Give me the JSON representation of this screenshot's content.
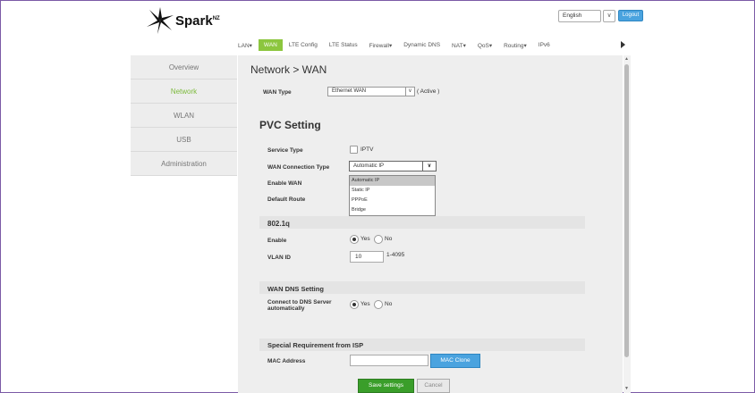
{
  "brand": {
    "name": "Spark",
    "suffix": "NZ"
  },
  "header": {
    "language": "English",
    "language_arrow": "∨",
    "logout": "Logout"
  },
  "topnav": [
    "LAN▾",
    "WAN",
    "LTE Config",
    "LTE Status",
    "Firewall▾",
    "Dynamic DNS",
    "NAT▾",
    "QoS▾",
    "Routing▾",
    "IPv6"
  ],
  "topnav_active": "WAN",
  "sidebar": [
    "Overview",
    "Network",
    "WLAN",
    "USB",
    "Administration"
  ],
  "sidebar_active": "Network",
  "breadcrumb": "Network > WAN",
  "wan_type": {
    "label": "WAN Type",
    "value": "Ethernet WAN",
    "status": "( Active )"
  },
  "pvc": {
    "title": "PVC Setting",
    "service_type_label": "Service Type",
    "iptv_label": "IPTV",
    "conn_type_label": "WAN Connection Type",
    "conn_type_value": "Automatic IP",
    "enable_wan_label": "Enable WAN",
    "default_route_label": "Default Route",
    "options": [
      "Automatic IP",
      "Static IP",
      "PPPoE",
      "Bridge"
    ],
    "selected_option": "Automatic IP"
  },
  "vlan": {
    "title": "802.1q",
    "enable_label": "Enable",
    "yes": "Yes",
    "no": "No",
    "vlan_id_label": "VLAN ID",
    "vlan_id_value": "10",
    "range": "1-4095"
  },
  "dns": {
    "title": "WAN DNS Setting",
    "connect_label_1": "Connect to DNS Server",
    "connect_label_2": "automatically",
    "yes": "Yes",
    "no": "No"
  },
  "isp": {
    "title": "Special Requirement from ISP",
    "mac_label": "MAC Address",
    "mac_value": "",
    "mac_clone": "MAC Clone"
  },
  "actions": {
    "save": "Save settings",
    "cancel": "Cancel"
  },
  "colors": {
    "accent": "#8cc63e",
    "blue": "#4aa3df",
    "save": "#3a9e2a"
  }
}
